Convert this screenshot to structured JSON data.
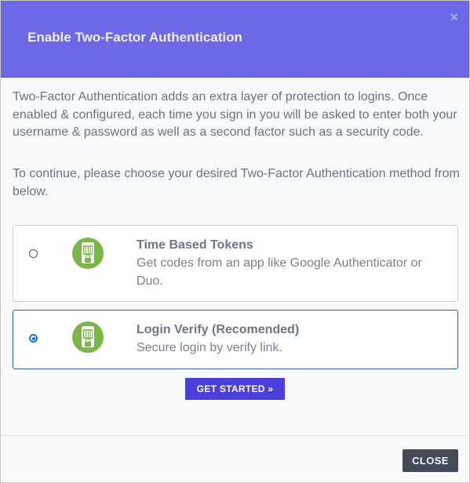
{
  "header": {
    "title": "Enable Two-Factor Authentication",
    "close_glyph": "×"
  },
  "body": {
    "intro": "Two-Factor Authentication adds an extra layer of protection to logins. Once enabled & configured, each time you sign in you will be asked to enter both your username & password as well as a second factor such as a security code.",
    "choose": "To continue, please choose your desired Two-Factor Authentication method from below."
  },
  "options": [
    {
      "title": "Time Based Tokens",
      "description": "Get codes from an app like Google Authenticator or Duo.",
      "selected": false,
      "icon": "phone-lock-icon"
    },
    {
      "title": "Login Verify (Recomended)",
      "description": "Secure login by verify link.",
      "selected": true,
      "icon": "phone-lock-icon"
    }
  ],
  "actions": {
    "get_started": "GET STARTED »",
    "close": "CLOSE"
  },
  "colors": {
    "header": "#6d68e6",
    "primary_button": "#4b3fd9",
    "close_button": "#444b58",
    "icon_green": "#7ab648",
    "selected_border": "#2d5f9e"
  }
}
